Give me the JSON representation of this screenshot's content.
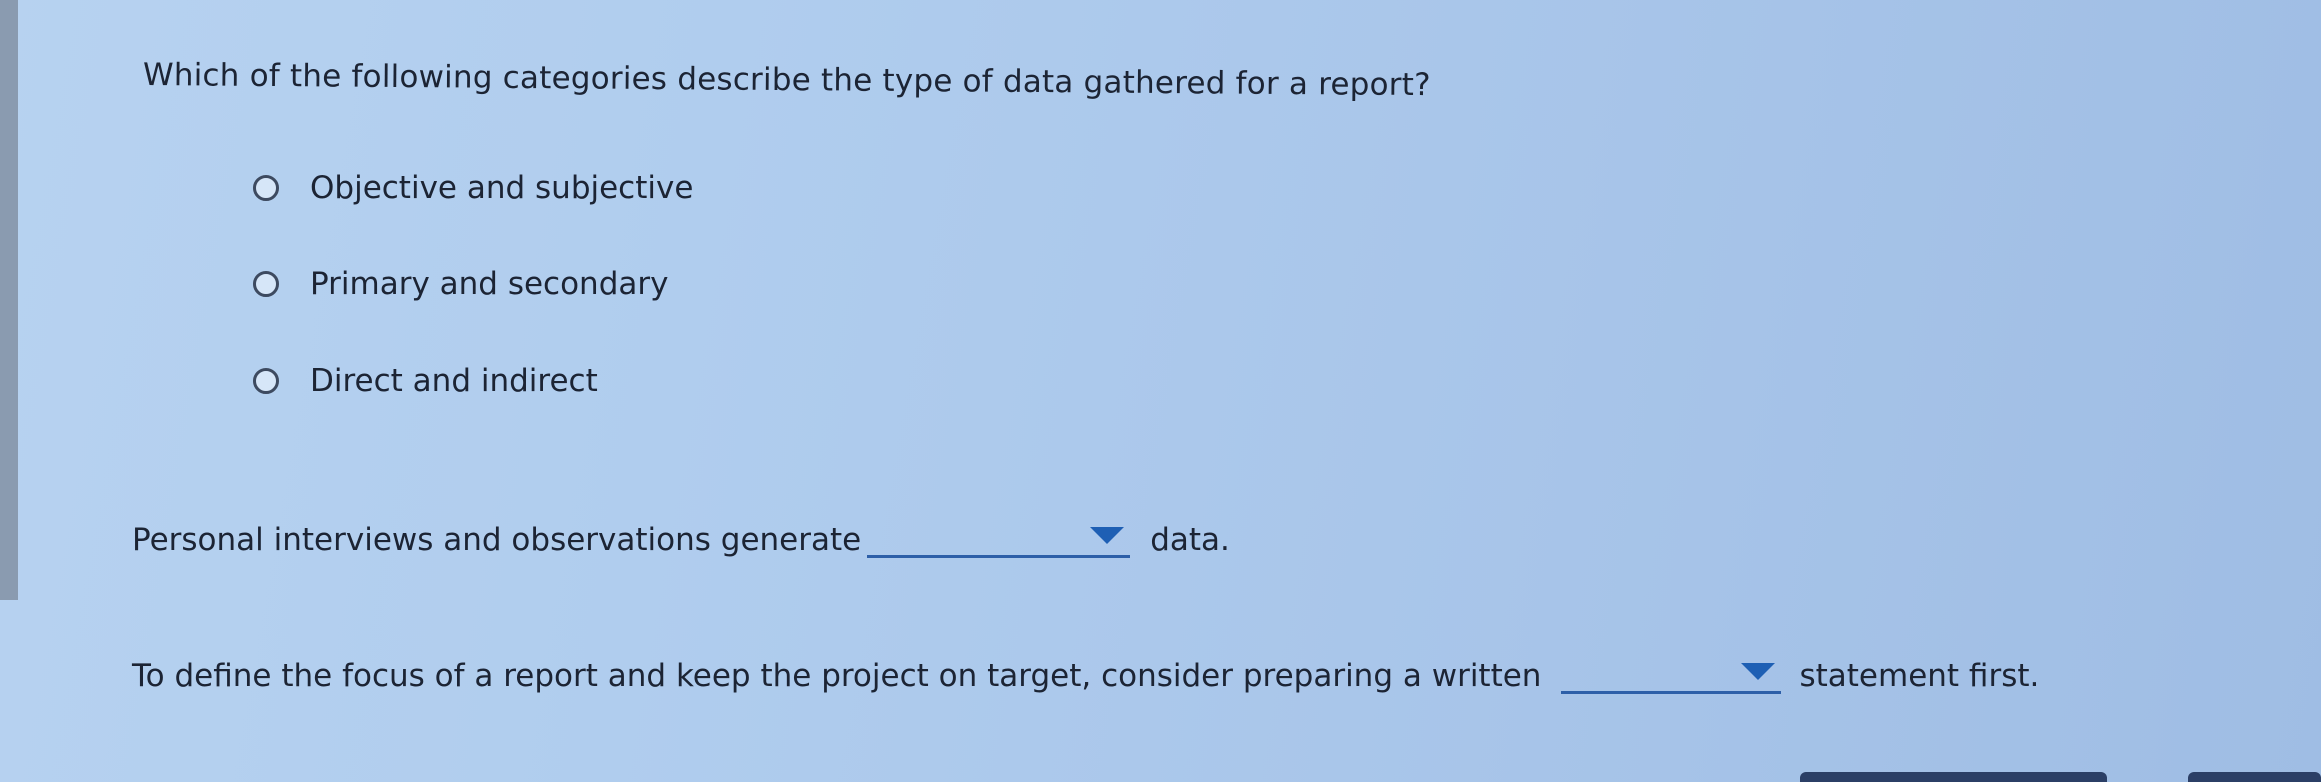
{
  "question1": {
    "text": "Which of the following categories describe the type of data gathered for a report?",
    "options": [
      {
        "label": "Objective and subjective"
      },
      {
        "label": "Primary and secondary"
      },
      {
        "label": "Direct and indirect"
      }
    ]
  },
  "question2": {
    "before": "Personal interviews and observations generate",
    "selected": "",
    "after": "data."
  },
  "question3": {
    "before": "To define the focus of a report and keep the project on target, consider preparing a written",
    "selected": "",
    "after": "statement first."
  },
  "colors": {
    "background": "#b0cdee",
    "text": "#1c2434",
    "dropdown_underline": "#2d5fa8",
    "caret": "#1e5fb4"
  }
}
